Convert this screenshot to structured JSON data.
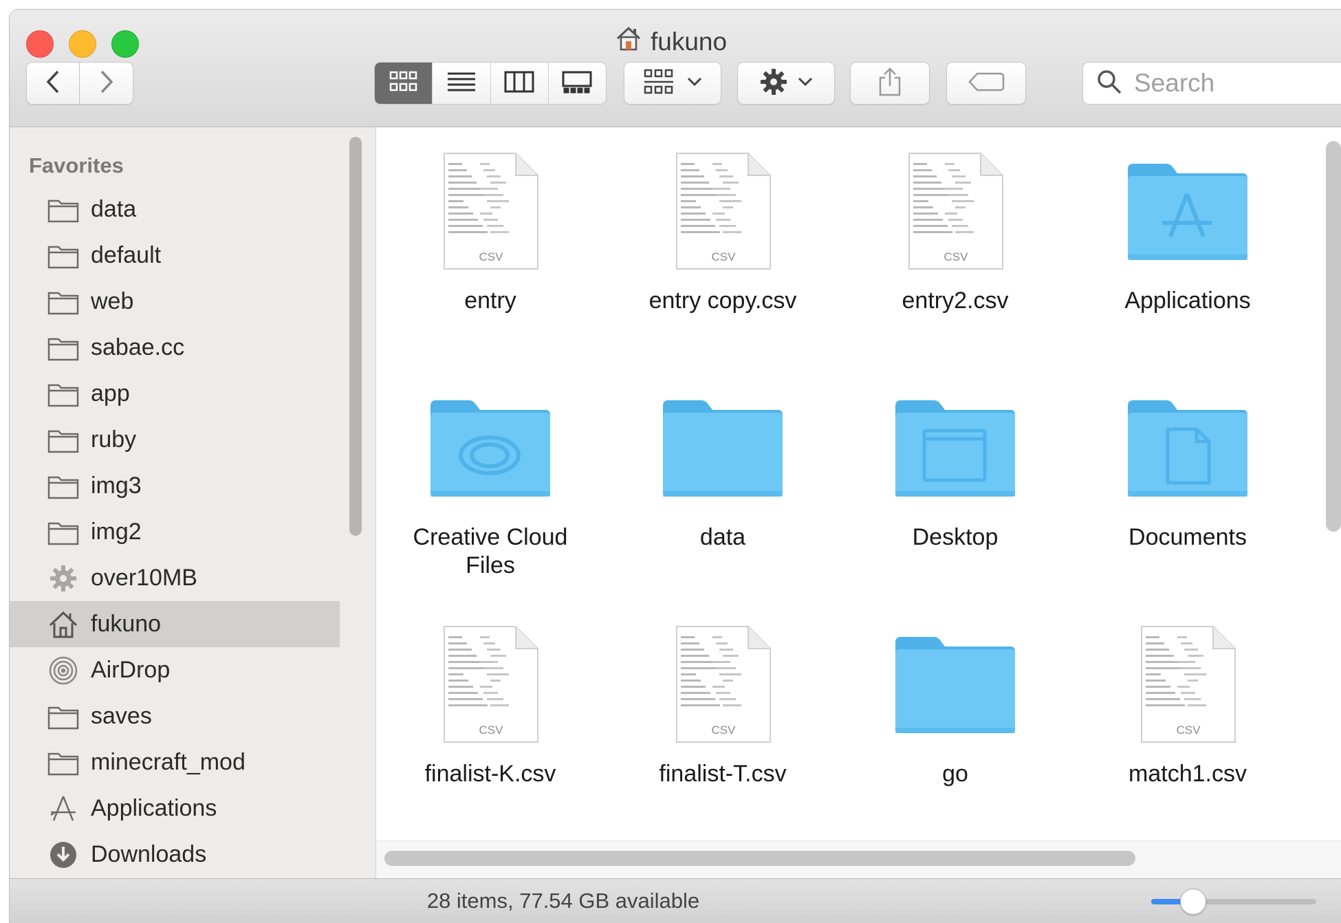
{
  "window": {
    "title": "fukuno",
    "title_icon": "home-icon"
  },
  "toolbar": {
    "back_icon": "chevron-left-icon",
    "forward_icon": "chevron-right-icon",
    "views": [
      "icon-view",
      "list-view",
      "column-view",
      "gallery-view"
    ],
    "active_view": "icon-view",
    "arrange_icon": "arrange-grid-icon",
    "action_icon": "gear-icon",
    "share_icon": "share-icon",
    "tag_icon": "tag-icon",
    "search_placeholder": "Search"
  },
  "sidebar": {
    "heading": "Favorites",
    "items": [
      {
        "label": "data",
        "icon": "folder-icon"
      },
      {
        "label": "default",
        "icon": "folder-icon"
      },
      {
        "label": "web",
        "icon": "folder-icon"
      },
      {
        "label": "sabae.cc",
        "icon": "folder-icon"
      },
      {
        "label": "app",
        "icon": "folder-icon"
      },
      {
        "label": "ruby",
        "icon": "folder-icon"
      },
      {
        "label": "img3",
        "icon": "folder-icon"
      },
      {
        "label": "img2",
        "icon": "folder-icon"
      },
      {
        "label": "over10MB",
        "icon": "gear-icon"
      },
      {
        "label": "fukuno",
        "icon": "home-icon",
        "selected": true
      },
      {
        "label": "AirDrop",
        "icon": "airdrop-icon"
      },
      {
        "label": "saves",
        "icon": "folder-icon"
      },
      {
        "label": "minecraft_mod",
        "icon": "folder-icon"
      },
      {
        "label": "Applications",
        "icon": "applications-icon"
      },
      {
        "label": "Downloads",
        "icon": "downloads-icon"
      }
    ]
  },
  "files": [
    {
      "name": "entry",
      "kind": "csv"
    },
    {
      "name": "entry copy.csv",
      "kind": "csv"
    },
    {
      "name": "entry2.csv",
      "kind": "csv"
    },
    {
      "name": "Applications",
      "kind": "folder-applications"
    },
    {
      "name": "Creative Cloud Files",
      "kind": "folder-creative-cloud"
    },
    {
      "name": "data",
      "kind": "folder"
    },
    {
      "name": "Desktop",
      "kind": "folder-desktop"
    },
    {
      "name": "Documents",
      "kind": "folder-documents"
    },
    {
      "name": "finalist-K.csv",
      "kind": "csv"
    },
    {
      "name": "finalist-T.csv",
      "kind": "csv"
    },
    {
      "name": "go",
      "kind": "folder"
    },
    {
      "name": "match1.csv",
      "kind": "csv"
    }
  ],
  "file_badge": "CSV",
  "status": {
    "text": "28 items, 77.54 GB available",
    "zoom_level": 0.25
  },
  "colors": {
    "folder": "#6dc8f6",
    "folder_dark": "#4fb3ea",
    "selection": "#d3cfce",
    "accent": "#3b8df0"
  }
}
